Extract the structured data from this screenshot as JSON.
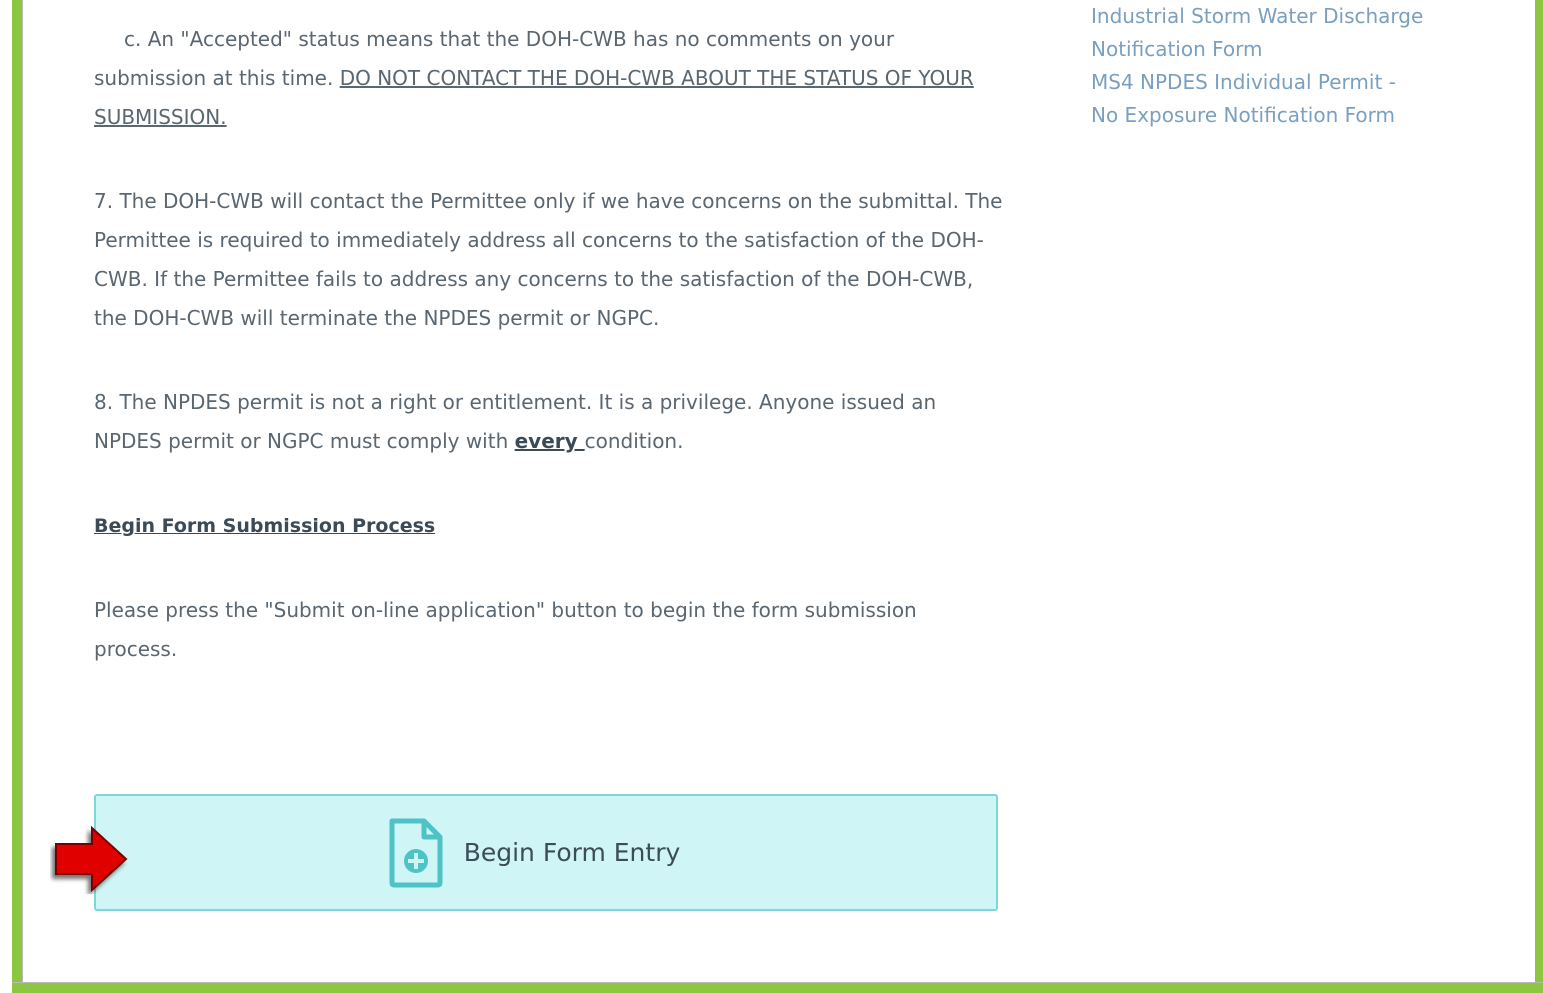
{
  "main": {
    "para_c_prefix": "c.    An \"Accepted\" status means that the DOH-CWB has no comments on your submission at this time.  ",
    "para_c_underlined": "DO NOT CONTACT THE DOH-CWB ABOUT THE STATUS OF YOUR SUBMISSION.",
    "para_7": "7.  The DOH-CWB will contact the Permittee only if we have concerns on the submittal.  The Permittee is required to immediately address all concerns to the satisfaction of the DOH-CWB.  If the Permittee fails to address any concerns to the satisfaction of the DOH-CWB, the DOH-CWB will terminate the NPDES permit or NGPC.",
    "para_8_prefix": "8.  The NPDES permit is not a right or entitlement.  It is a privilege.  Anyone issued an NPDES permit or NGPC must comply with ",
    "para_8_emphasis": "every ",
    "para_8_suffix": "condition.",
    "section_title": "Begin Form Submission Process",
    "instruction": "Please press the \"Submit on-line application\" button to begin the form submission process.",
    "begin_button_label": "Begin Form Entry"
  },
  "sidebar": {
    "links": [
      {
        "label": "Industrial Storm Water Discharge Notification Form"
      },
      {
        "label": "MS4 NPDES Individual Permit - No Exposure Notification Form"
      }
    ]
  },
  "icons": {
    "begin_button_icon": "file-plus-icon",
    "pointer": "red-arrow-icon",
    "scroll_up": "triangle-up-icon",
    "scroll_down": "triangle-down-icon"
  },
  "colors": {
    "window_border": "#8dc63f",
    "body_text": "#5a6670",
    "link_text": "#7aa0c0",
    "button_bg": "#cff5f6",
    "button_border": "#7dd6d8",
    "arrow": "#e00000"
  }
}
